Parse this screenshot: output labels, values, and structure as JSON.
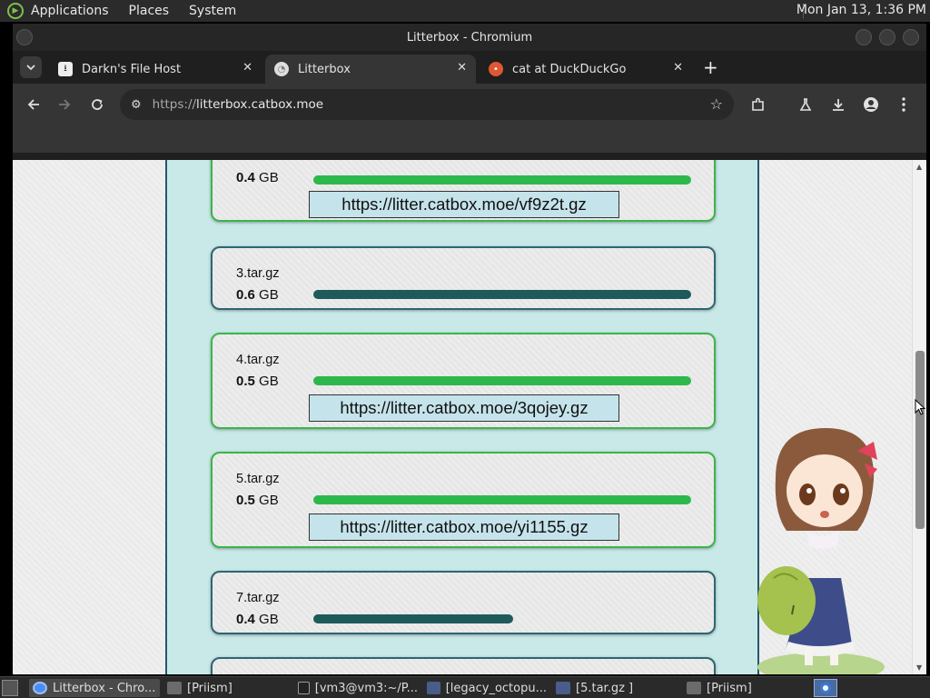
{
  "top_panel": {
    "menus": [
      "Applications",
      "Places",
      "System"
    ],
    "clock": "Mon Jan 13,  1:36 PM"
  },
  "window": {
    "title": "Litterbox - Chromium"
  },
  "tabs": [
    {
      "label": "Darkn's File Host",
      "icon": "download-icon",
      "active": false
    },
    {
      "label": "Litterbox",
      "icon": "litterbox-favicon",
      "active": true
    },
    {
      "label": "cat at DuckDuckGo",
      "icon": "duckduckgo-icon",
      "active": false
    }
  ],
  "omnibox": {
    "scheme": "https://",
    "host": "litterbox.catbox.moe"
  },
  "files": [
    {
      "name": "",
      "size_num": "0.4",
      "size_unit": "GB",
      "progress": 1.0,
      "complete": true,
      "link": "https://litter.catbox.moe/vf9z2t.gz"
    },
    {
      "name": "3.tar.gz",
      "size_num": "0.6",
      "size_unit": "GB",
      "progress": 1.0,
      "complete": false,
      "link": ""
    },
    {
      "name": "4.tar.gz",
      "size_num": "0.5",
      "size_unit": "GB",
      "progress": 1.0,
      "complete": true,
      "link": "https://litter.catbox.moe/3qojey.gz"
    },
    {
      "name": "5.tar.gz",
      "size_num": "0.5",
      "size_unit": "GB",
      "progress": 1.0,
      "complete": true,
      "link": "https://litter.catbox.moe/yi1155.gz"
    },
    {
      "name": "7.tar.gz",
      "size_num": "0.4",
      "size_unit": "GB",
      "progress": 0.53,
      "complete": false,
      "link": ""
    }
  ],
  "taskbar": {
    "tasks": [
      {
        "label": "Litterbox - Chro...",
        "icon": "chromium-icon",
        "active": true
      },
      {
        "label": "[Priism]",
        "icon": "folder-icon",
        "active": false
      },
      {
        "label": "[vm3@vm3:~/P...",
        "icon": "terminal-icon",
        "active": false
      },
      {
        "label": "[legacy_octopu...",
        "icon": "archive-icon",
        "active": false
      },
      {
        "label": "[5.tar.gz ]",
        "icon": "archive-icon",
        "active": false
      },
      {
        "label": "[Priism]",
        "icon": "folder-icon",
        "active": false
      }
    ]
  },
  "colors": {
    "progress_complete": "#2db84b",
    "progress_pending": "#1f5a5a",
    "card_border_complete": "#3bb54a",
    "card_border_pending": "#2e6672",
    "content_bg": "#c9e9e9"
  }
}
